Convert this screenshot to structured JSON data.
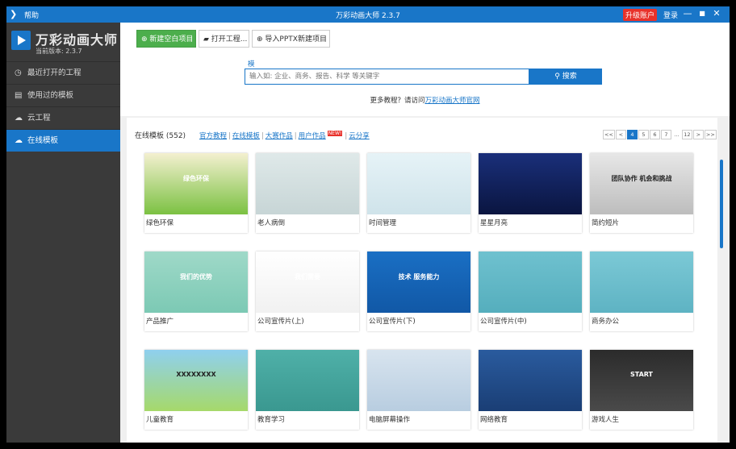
{
  "titlebar": {
    "help": "帮助",
    "title": "万彩动画大师 2.3.7",
    "upgrade": "升级账户",
    "login": "登录",
    "minimize": "—",
    "maximize": "■",
    "close": "✕"
  },
  "sidebar": {
    "brand_name": "万彩动画大师",
    "version": "当前版本: 2.3.7",
    "items": [
      {
        "label": "最近打开的工程",
        "icon": "clock-icon",
        "glyph": "◷"
      },
      {
        "label": "使用过的模板",
        "icon": "template-icon",
        "glyph": "▤"
      },
      {
        "label": "云工程",
        "icon": "cloud-icon",
        "glyph": "☁"
      },
      {
        "label": "在线模板",
        "icon": "cloud-icon",
        "glyph": "☁"
      }
    ]
  },
  "toolbar": {
    "new_blank": "新建空白项目",
    "open_project": "打开工程...",
    "import_pptx": "导入PPTX新建项目"
  },
  "search": {
    "label": "模板",
    "placeholder": "输入如: 企业、商务、报告、科学 等关键字",
    "button": "搜索"
  },
  "tutorial": {
    "text": "更多教程？请访问",
    "link": "万彩动画大师官网"
  },
  "templates": {
    "heading": "在线模板 (552)",
    "tabs": [
      "官方教程",
      "在线模板",
      "大赛作品",
      "用户作品",
      "云分享"
    ],
    "new_badge": "NEW!",
    "pager": [
      "<<",
      "<",
      "4",
      "5",
      "6",
      "7",
      "...",
      "12",
      ">",
      ">>"
    ],
    "current_page": "4",
    "items": [
      {
        "label": "绿色环保",
        "colors": [
          "#f4f0d0",
          "#7bc142"
        ],
        "overlay": "绿色环保"
      },
      {
        "label": "老人病倒",
        "colors": [
          "#dfe9e9",
          "#c7d5d6"
        ],
        "overlay": ""
      },
      {
        "label": "时间管理",
        "colors": [
          "#e6f3f7",
          "#cfe3ea"
        ],
        "overlay": ""
      },
      {
        "label": "星星月亮",
        "colors": [
          "#1a2f7a",
          "#0a1540"
        ],
        "overlay": ""
      },
      {
        "label": "简约短片",
        "colors": [
          "#e7e7e7",
          "#bdbdbd"
        ],
        "overlay": "团队协作 机会和挑战"
      },
      {
        "label": "产品推广",
        "colors": [
          "#9fd9c8",
          "#7cc9b4"
        ],
        "overlay": "我们的优势"
      },
      {
        "label": "公司宣传片(上)",
        "colors": [
          "#ffffff",
          "#f1f1f1"
        ],
        "overlay": "我们需要"
      },
      {
        "label": "公司宣传片(下)",
        "colors": [
          "#1a6fc4",
          "#1158a6"
        ],
        "overlay": "技术 服务能力"
      },
      {
        "label": "公司宣传片(中)",
        "colors": [
          "#6fc1cf",
          "#55aebd"
        ],
        "overlay": ""
      },
      {
        "label": "商务办公",
        "colors": [
          "#7cc9d6",
          "#5eb3c3"
        ],
        "overlay": ""
      },
      {
        "label": "儿童教育",
        "colors": [
          "#8fd0ef",
          "#a6d96a"
        ],
        "overlay": "XXXXXXXX"
      },
      {
        "label": "教育学习",
        "colors": [
          "#4fb0a8",
          "#3a9890"
        ],
        "overlay": ""
      },
      {
        "label": "电脑屏幕操作",
        "colors": [
          "#d8e4ef",
          "#b8cde0"
        ],
        "overlay": ""
      },
      {
        "label": "网络教育",
        "colors": [
          "#2a5b9e",
          "#1a3e75"
        ],
        "overlay": ""
      },
      {
        "label": "游戏人生",
        "colors": [
          "#2b2b2b",
          "#4a4a4a"
        ],
        "overlay": "START"
      }
    ]
  }
}
